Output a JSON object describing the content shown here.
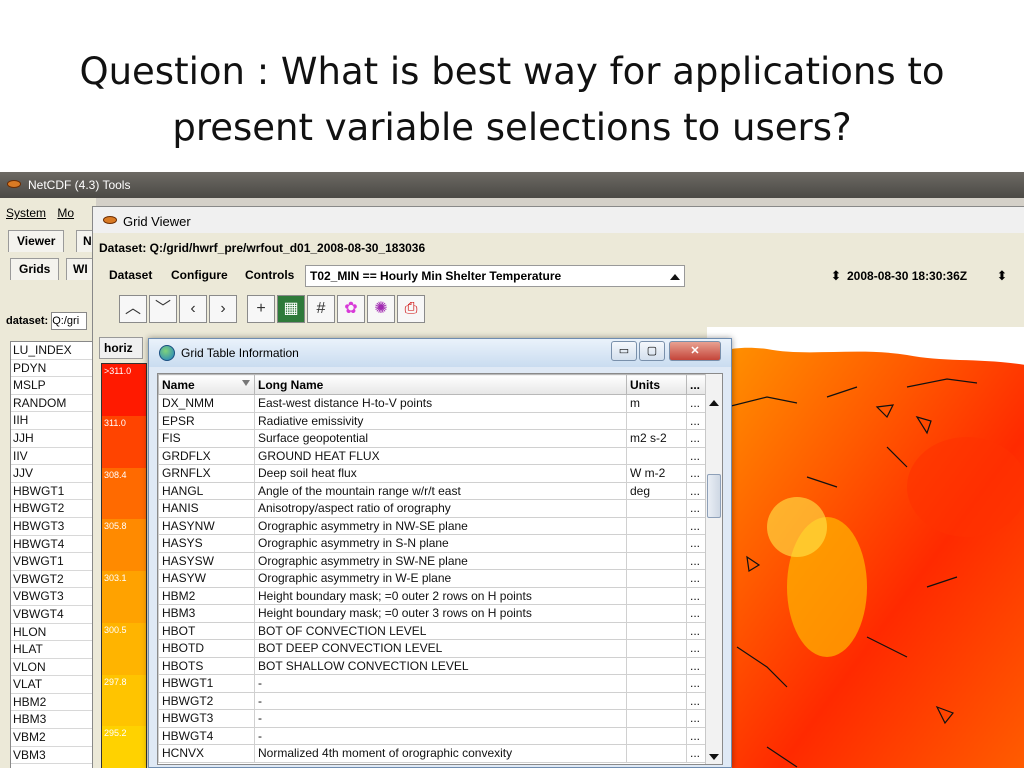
{
  "slide": {
    "title_line1": "Question : What is best way for applications to",
    "title_line2": "present variable selections to users?"
  },
  "back_window": {
    "title": "NetCDF (4.3) Tools",
    "menu": [
      "System",
      "Mo"
    ],
    "tab_viewer": "Viewer",
    "tab_partial": "N",
    "subtab_grids": "Grids",
    "subtab_partial": "WI",
    "dataset_label": "dataset:",
    "dataset_value": "Q:/gri",
    "variables": [
      "LU_INDEX",
      "PDYN",
      "MSLP",
      "RANDOM",
      "IIH",
      "JJH",
      "IIV",
      "JJV",
      "HBWGT1",
      "HBWGT2",
      "HBWGT3",
      "HBWGT4",
      "VBWGT1",
      "VBWGT2",
      "VBWGT3",
      "VBWGT4",
      "HLON",
      "HLAT",
      "VLON",
      "VLAT",
      "HBM2",
      "HBM3",
      "VBM2",
      "VBM3"
    ]
  },
  "grid_viewer": {
    "title": "Grid Viewer",
    "dataset": "Dataset:  Q:/grid/hwrf_pre/wrfout_d01_2008-08-30_183036",
    "menu_dataset": "Dataset",
    "menu_configure": "Configure",
    "menu_controls": "Controls",
    "variable_selected": "T02_MIN == Hourly Min Shelter Temperature",
    "time_selected": "2008-08-30 18:30:36Z",
    "horiz_tab": "horiz",
    "colorbar_labels": [
      ">311.0",
      "311.0",
      "308.4",
      "305.8",
      "303.1",
      "300.5",
      "297.8",
      "295.2"
    ]
  },
  "colors": {
    "colorbar": [
      "#ff1a00",
      "#ff4400",
      "#ff6a00",
      "#ff8a00",
      "#ffa200",
      "#ffb400",
      "#ffc400",
      "#ffd200"
    ]
  },
  "dialog": {
    "title": "Grid Table Information",
    "minimize": "▭",
    "maximize": "▢",
    "close": "✕",
    "columns": [
      "Name",
      "Long Name",
      "Units",
      "..."
    ],
    "rows": [
      {
        "name": "DX_NMM",
        "long_name": "East-west distance H-to-V points",
        "units": "m",
        "more": "..."
      },
      {
        "name": "EPSR",
        "long_name": "Radiative emissivity",
        "units": "",
        "more": "..."
      },
      {
        "name": "FIS",
        "long_name": "Surface geopotential",
        "units": "m2 s-2",
        "more": "..."
      },
      {
        "name": "GRDFLX",
        "long_name": "GROUND HEAT FLUX",
        "units": "",
        "more": "..."
      },
      {
        "name": "GRNFLX",
        "long_name": "Deep soil heat flux",
        "units": "W m-2",
        "more": "..."
      },
      {
        "name": "HANGL",
        "long_name": "Angle of the mountain range w/r/t east",
        "units": "deg",
        "more": "..."
      },
      {
        "name": "HANIS",
        "long_name": "Anisotropy/aspect ratio of orography",
        "units": "",
        "more": "..."
      },
      {
        "name": "HASYNW",
        "long_name": "Orographic asymmetry in NW-SE plane",
        "units": "",
        "more": "..."
      },
      {
        "name": "HASYS",
        "long_name": "Orographic asymmetry in S-N plane",
        "units": "",
        "more": "..."
      },
      {
        "name": "HASYSW",
        "long_name": "Orographic asymmetry in SW-NE plane",
        "units": "",
        "more": "..."
      },
      {
        "name": "HASYW",
        "long_name": "Orographic asymmetry in W-E plane",
        "units": "",
        "more": "..."
      },
      {
        "name": "HBM2",
        "long_name": "Height boundary mask; =0 outer 2 rows on H points",
        "units": "",
        "more": "..."
      },
      {
        "name": "HBM3",
        "long_name": "Height boundary mask; =0 outer 3 rows on H points",
        "units": "",
        "more": "..."
      },
      {
        "name": "HBOT",
        "long_name": "BOT OF CONVECTION LEVEL",
        "units": "",
        "more": "..."
      },
      {
        "name": "HBOTD",
        "long_name": "BOT DEEP CONVECTION LEVEL",
        "units": "",
        "more": "..."
      },
      {
        "name": "HBOTS",
        "long_name": "BOT SHALLOW CONVECTION LEVEL",
        "units": "",
        "more": "..."
      },
      {
        "name": "HBWGT1",
        "long_name": "-",
        "units": "",
        "more": "..."
      },
      {
        "name": "HBWGT2",
        "long_name": "-",
        "units": "",
        "more": "..."
      },
      {
        "name": "HBWGT3",
        "long_name": "-",
        "units": "",
        "more": "..."
      },
      {
        "name": "HBWGT4",
        "long_name": "-",
        "units": "",
        "more": "..."
      },
      {
        "name": "HCNVX",
        "long_name": "Normalized 4th moment of orographic convexity",
        "units": "",
        "more": "..."
      }
    ]
  },
  "icons": {
    "toolbar": [
      "chevron-up-icon",
      "chevron-down-icon",
      "chevron-left-icon",
      "chevron-right-icon",
      "plus-icon",
      "map-icon",
      "grid-icon",
      "projection-icon",
      "color-icon",
      "print-icon"
    ]
  }
}
